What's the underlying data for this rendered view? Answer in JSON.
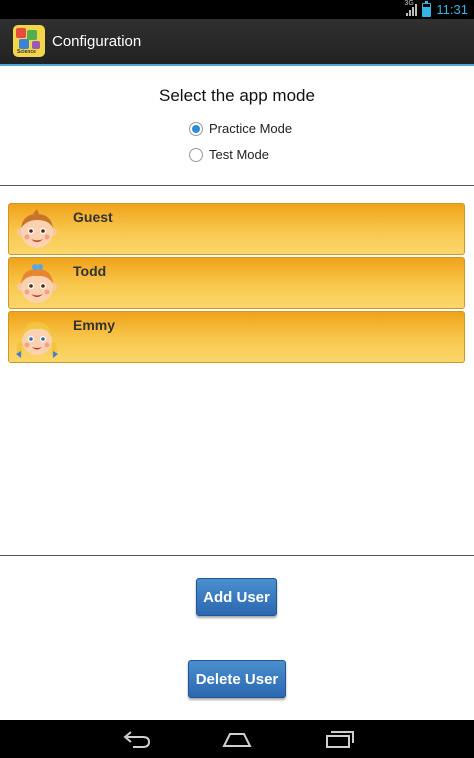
{
  "status_bar": {
    "network": "3G",
    "time": "11:31",
    "accent": "#33b5e5"
  },
  "action_bar": {
    "title": "Configuration",
    "icon": "kids-science-app-icon"
  },
  "mode": {
    "title": "Select the app mode",
    "options": [
      {
        "label": "Practice Mode",
        "checked": true
      },
      {
        "label": "Test Mode",
        "checked": false
      }
    ]
  },
  "users": [
    {
      "name": "Guest",
      "avatar": "boy-face-icon"
    },
    {
      "name": "Todd",
      "avatar": "girl-face-icon"
    },
    {
      "name": "Emmy",
      "avatar": "girl-pigtails-face-icon"
    }
  ],
  "buttons": {
    "add_user": "Add User",
    "delete_user": "Delete User"
  },
  "nav_bar": {
    "back": "back-icon",
    "home": "home-icon",
    "recents": "recent-apps-icon"
  },
  "colors": {
    "row_top": "#f0a31a",
    "row_bottom": "#fbd66b",
    "button_blue": "#2b68b0",
    "radio_blue": "#2c8ed6"
  }
}
